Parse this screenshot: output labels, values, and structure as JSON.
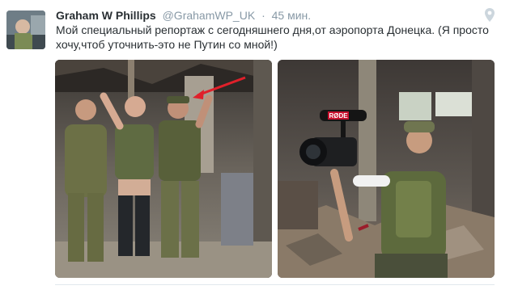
{
  "tweet": {
    "author_name": "Graham W Phillips",
    "author_handle": "@GrahamWP_UK",
    "separator": "·",
    "time": "45 мин.",
    "text": "Мой специальный репортаж с сегодняшнего дня,от аэропорта Донецка. (Я просто хочу,чтоб уточнить-это не Путин со мной!)",
    "icons": [
      "avatar",
      "location-pin-icon"
    ]
  },
  "media": {
    "left_photo_text": "",
    "right_photo_text": "",
    "camera_mic_label": "RØDE"
  },
  "colors": {
    "name": "#292f33",
    "meta": "#8899a6",
    "annotation_arrow": "#e0202a"
  }
}
